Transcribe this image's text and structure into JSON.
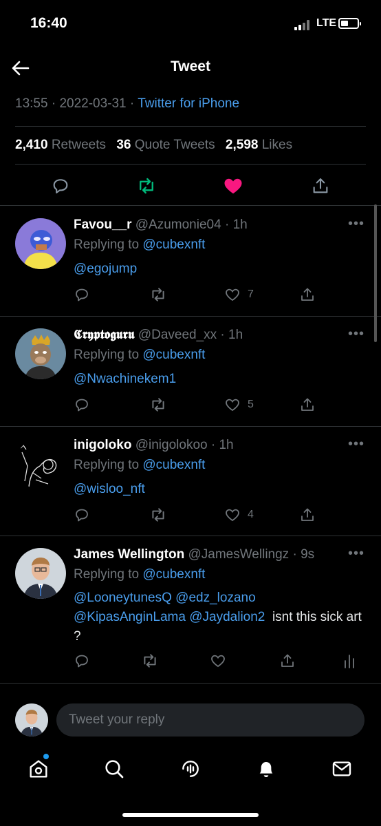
{
  "status": {
    "time": "16:40",
    "network": "LTE"
  },
  "header": {
    "title": "Tweet"
  },
  "tweet": {
    "time": "13:55",
    "date": "2022-03-31",
    "source": "Twitter for iPhone",
    "retweets_count": "2,410",
    "retweets_label": "Retweets",
    "quotes_count": "36",
    "quotes_label": "Quote Tweets",
    "likes_count": "2,598",
    "likes_label": "Likes",
    "liked": true
  },
  "replies": [
    {
      "name": "Favou__r",
      "handle": "@Azumonie04",
      "age": "1h",
      "replying_label": "Replying to",
      "replying_to": "@cubexnft",
      "body_mentions": [
        "@egojump"
      ],
      "body_text": "",
      "likes": "7"
    },
    {
      "name": "𝕮𝖗𝖞𝖕𝖙𝖔𝖌𝖚𝖗𝖚",
      "handle": "@Daveed_xx",
      "age": "1h",
      "replying_label": "Replying to",
      "replying_to": "@cubexnft",
      "body_mentions": [
        "@Nwachinekem1"
      ],
      "body_text": "",
      "likes": "5"
    },
    {
      "name": "inigoloko",
      "handle": "@inigolokoo",
      "age": "1h",
      "replying_label": "Replying to",
      "replying_to": "@cubexnft",
      "body_mentions": [
        "@wisloo_nft"
      ],
      "body_text": "",
      "likes": "4"
    },
    {
      "name": "James Wellington",
      "handle": "@JamesWellingz",
      "age": "9s",
      "replying_label": "Replying to",
      "replying_to": "@cubexnft",
      "body_mentions": [
        "@LooneytunesQ",
        "@edz_lozano",
        "@KipasAnginLama",
        "@Jaydalion2"
      ],
      "body_text": "isnt this sick art ?",
      "likes": ""
    }
  ],
  "composer": {
    "placeholder": "Tweet your reply"
  },
  "colors": {
    "accent": "#4a9eed",
    "like": "#f91880",
    "retweet": "#00ba7c",
    "background": "#000000"
  },
  "icons": [
    "back-arrow-icon",
    "reply-icon",
    "retweet-icon",
    "heart-icon",
    "share-icon",
    "more-icon",
    "analytics-icon",
    "home-icon",
    "search-icon",
    "spaces-icon",
    "notifications-icon",
    "messages-icon"
  ]
}
